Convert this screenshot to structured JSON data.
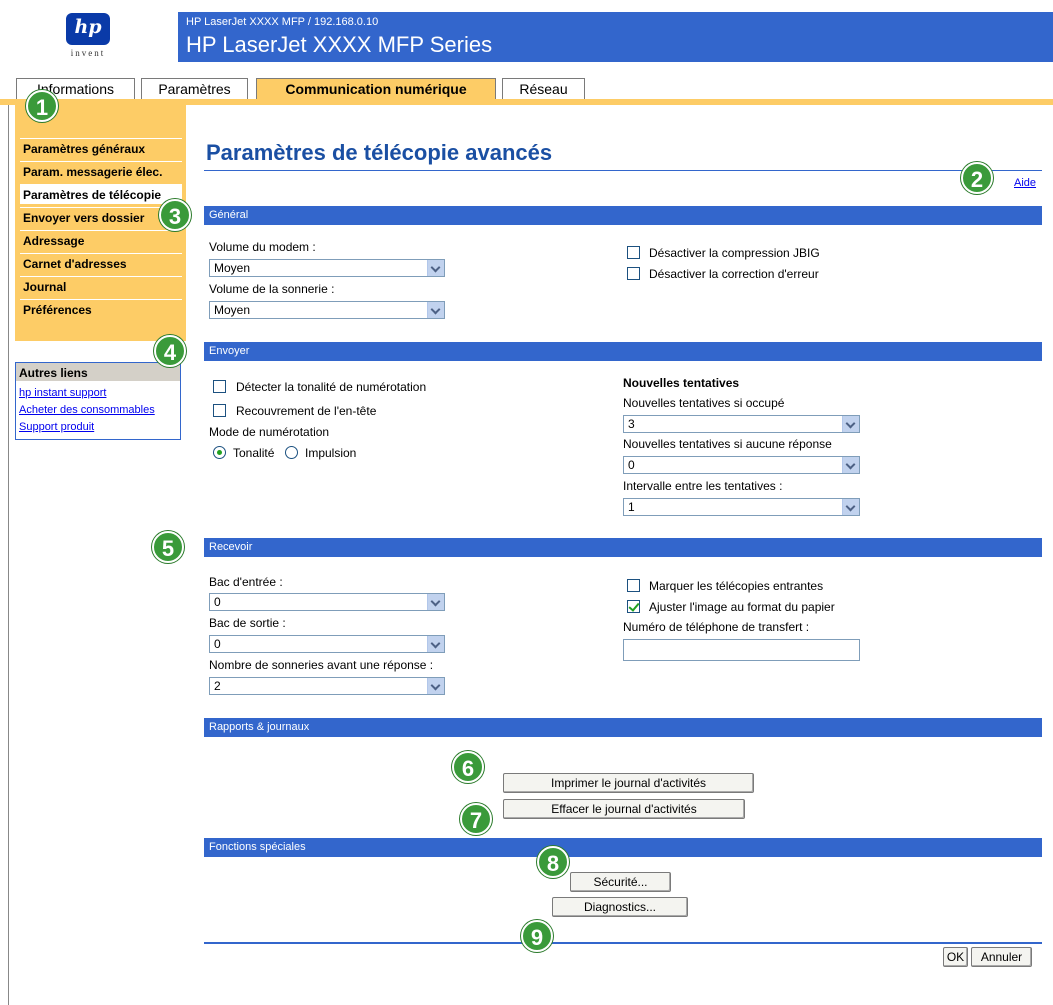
{
  "header": {
    "logo_mark": "hp",
    "logo_tagline": "invent",
    "device_address": "HP LaserJet XXXX MFP / 192.168.0.10",
    "device_name": "HP LaserJet XXXX MFP Series"
  },
  "tabs": [
    {
      "label": "Informations",
      "active": false
    },
    {
      "label": "Paramètres",
      "active": false
    },
    {
      "label": "Communication numérique",
      "active": true
    },
    {
      "label": "Réseau",
      "active": false
    }
  ],
  "sidebar": {
    "items": [
      {
        "label": "Paramètres généraux"
      },
      {
        "label": "Param. messagerie élec."
      },
      {
        "label": "Paramètres de télécopie"
      },
      {
        "label": "Envoyer vers dossier"
      },
      {
        "label": "Adressage"
      },
      {
        "label": "Carnet d'adresses"
      },
      {
        "label": "Journal"
      },
      {
        "label": "Préférences"
      }
    ],
    "selected_index": 2
  },
  "other_links": {
    "title": "Autres liens",
    "links": [
      "hp instant support",
      "Acheter des consommables",
      "Support produit"
    ]
  },
  "main": {
    "title": "Paramètres de télécopie avancés",
    "help_link": "Aide"
  },
  "general": {
    "title": "Général",
    "modem_volume_label": "Volume du modem :",
    "modem_volume_value": "Moyen",
    "ring_volume_label": "Volume de la sonnerie :",
    "ring_volume_value": "Moyen",
    "jbig_label": "Désactiver la compression JBIG",
    "jbig_checked": false,
    "ecm_label": "Désactiver la correction d'erreur",
    "ecm_checked": false
  },
  "send": {
    "title": "Envoyer",
    "dial_tone_label": "Détecter la tonalité de numérotation",
    "header_overlay_label": "Recouvrement de l'en-tête",
    "dial_mode_label": "Mode de numérotation",
    "tone_label": "Tonalité",
    "pulse_label": "Impulsion",
    "dial_mode_selected": "Tonalité",
    "redial_title": "Nouvelles tentatives",
    "redial_busy_label": "Nouvelles tentatives si occupé",
    "redial_busy_value": "3",
    "redial_noanswer_label": "Nouvelles tentatives si aucune réponse",
    "redial_noanswer_value": "0",
    "redial_interval_label": "Intervalle entre les tentatives :",
    "redial_interval_value": "1"
  },
  "receive": {
    "title": "Recevoir",
    "input_tray_label": "Bac d'entrée :",
    "input_tray_value": "0",
    "output_bin_label": "Bac de sortie :",
    "output_bin_value": "0",
    "rings_label": "Nombre de sonneries avant une réponse :",
    "rings_value": "2",
    "stamp_label": "Marquer les télécopies entrantes",
    "stamp_checked": false,
    "fit_label": "Ajuster l'image au format du papier",
    "fit_checked": true,
    "forward_label": "Numéro de téléphone de transfert :",
    "forward_value": ""
  },
  "reports": {
    "title": "Rapports & journaux",
    "print_log_button": "Imprimer le journal d'activités",
    "clear_log_button": "Effacer le journal d'activités"
  },
  "special": {
    "title": "Fonctions spéciales",
    "security_button": "Sécurité...",
    "diagnostics_button": "Diagnostics..."
  },
  "footer": {
    "ok_button": "OK",
    "cancel_button": "Annuler"
  },
  "callouts": [
    "1",
    "2",
    "3",
    "4",
    "5",
    "6",
    "7",
    "8",
    "9"
  ],
  "colors": {
    "title_bar": "#3366cc",
    "tab_active": "#fdcc66",
    "sidebar": "#fdcc66",
    "callout": "#3a9a3a"
  }
}
